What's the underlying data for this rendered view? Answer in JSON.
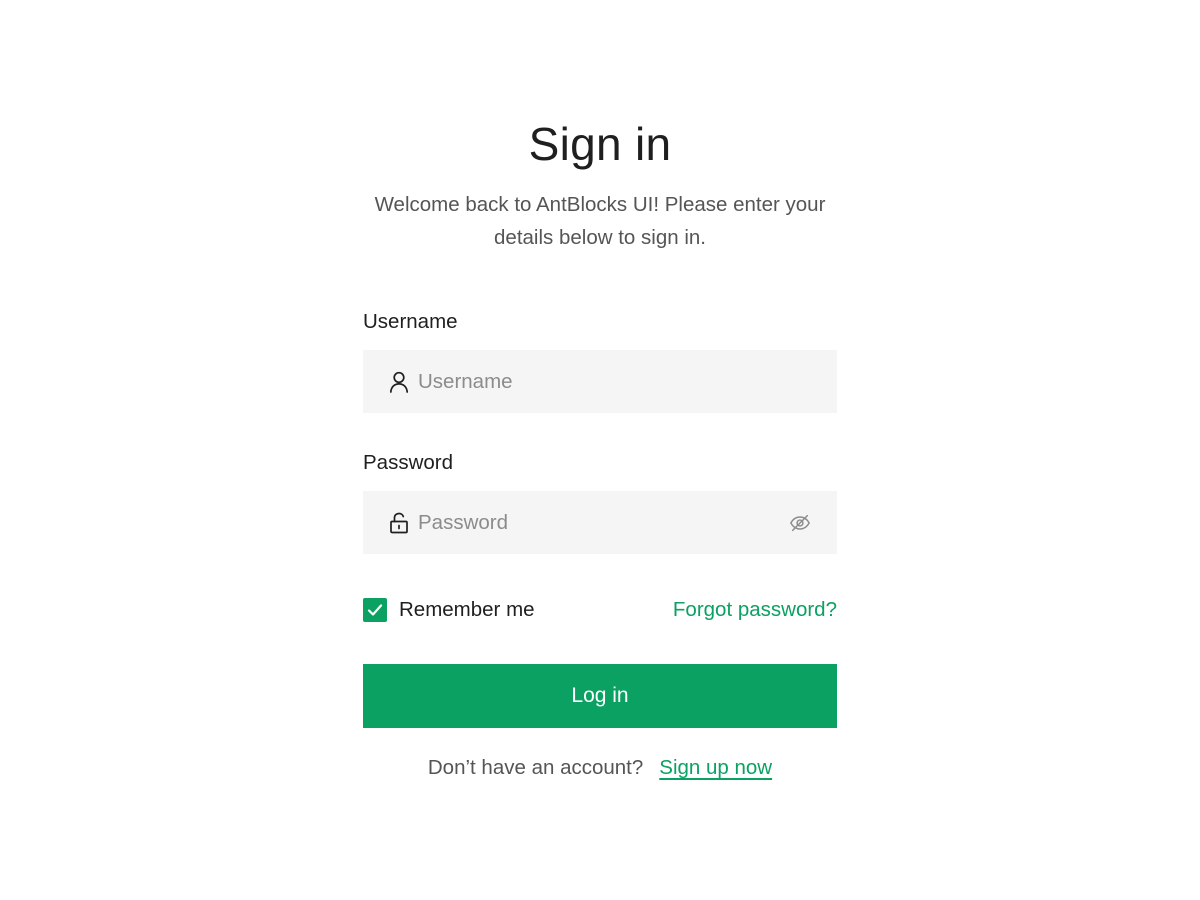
{
  "header": {
    "title": "Sign in",
    "subtitle": "Welcome back to AntBlocks UI! Please enter your details below to sign in."
  },
  "form": {
    "username": {
      "label": "Username",
      "placeholder": "Username",
      "value": "",
      "icon": "user-icon"
    },
    "password": {
      "label": "Password",
      "placeholder": "Password",
      "value": "",
      "icon": "unlock-icon",
      "toggle_icon": "eye-off-icon"
    },
    "remember": {
      "label": "Remember me",
      "checked": true
    },
    "forgot_label": "Forgot password?",
    "submit_label": "Log in"
  },
  "footer": {
    "prompt": "Don’t have an account?",
    "signup_label": "Sign up now"
  },
  "colors": {
    "accent": "#0ba162",
    "input_bg": "#f5f5f5",
    "text_primary": "#1f1f1f",
    "text_secondary": "#555555",
    "placeholder": "#8c8c8c"
  }
}
